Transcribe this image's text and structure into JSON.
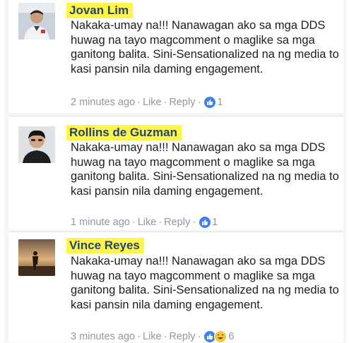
{
  "comments": [
    {
      "name": "Jovan Lim",
      "text": "Nakaka-umay na!!! Nanawagan ako sa mga DDS huwag na tayo magcomment o maglike sa mga ganitong balita. Sini-Sensationalized na ng media to kasi pansin nila daming engagement.",
      "time": "2 minutes ago",
      "like_label": "Like",
      "reply_label": "Reply",
      "reaction_count": "1"
    },
    {
      "name": "Rollins de Guzman",
      "text": "Nakaka-umay na!!! Nanawagan ako sa mga DDS huwag na tayo magcomment o maglike sa mga ganitong balita. Sini-Sensationalized na ng media to kasi pansin nila daming engagement.",
      "time": "1 minute ago",
      "like_label": "Like",
      "reply_label": "Reply",
      "reaction_count": "1"
    },
    {
      "name": "Vince Reyes",
      "text": "Nakaka-umay na!!! Nanawagan ako sa mga DDS huwag na tayo magcomment o maglike sa mga ganitong balita. Sini-Sensationalized na ng media to kasi pansin nila daming engagement.",
      "time": "3 minutes ago",
      "like_label": "Like",
      "reply_label": "Reply",
      "reaction_count": "6"
    }
  ],
  "separator": "·",
  "colors": {
    "name_link": "#23446f",
    "name_highlight": "#fff54a",
    "meta_text": "#9197a3",
    "like_blue": "#3b82f0",
    "haha_yellow": "#f8c631"
  },
  "icons": {
    "like_reaction": "thumbs-up-icon",
    "haha_reaction": "laughing-face-icon"
  }
}
